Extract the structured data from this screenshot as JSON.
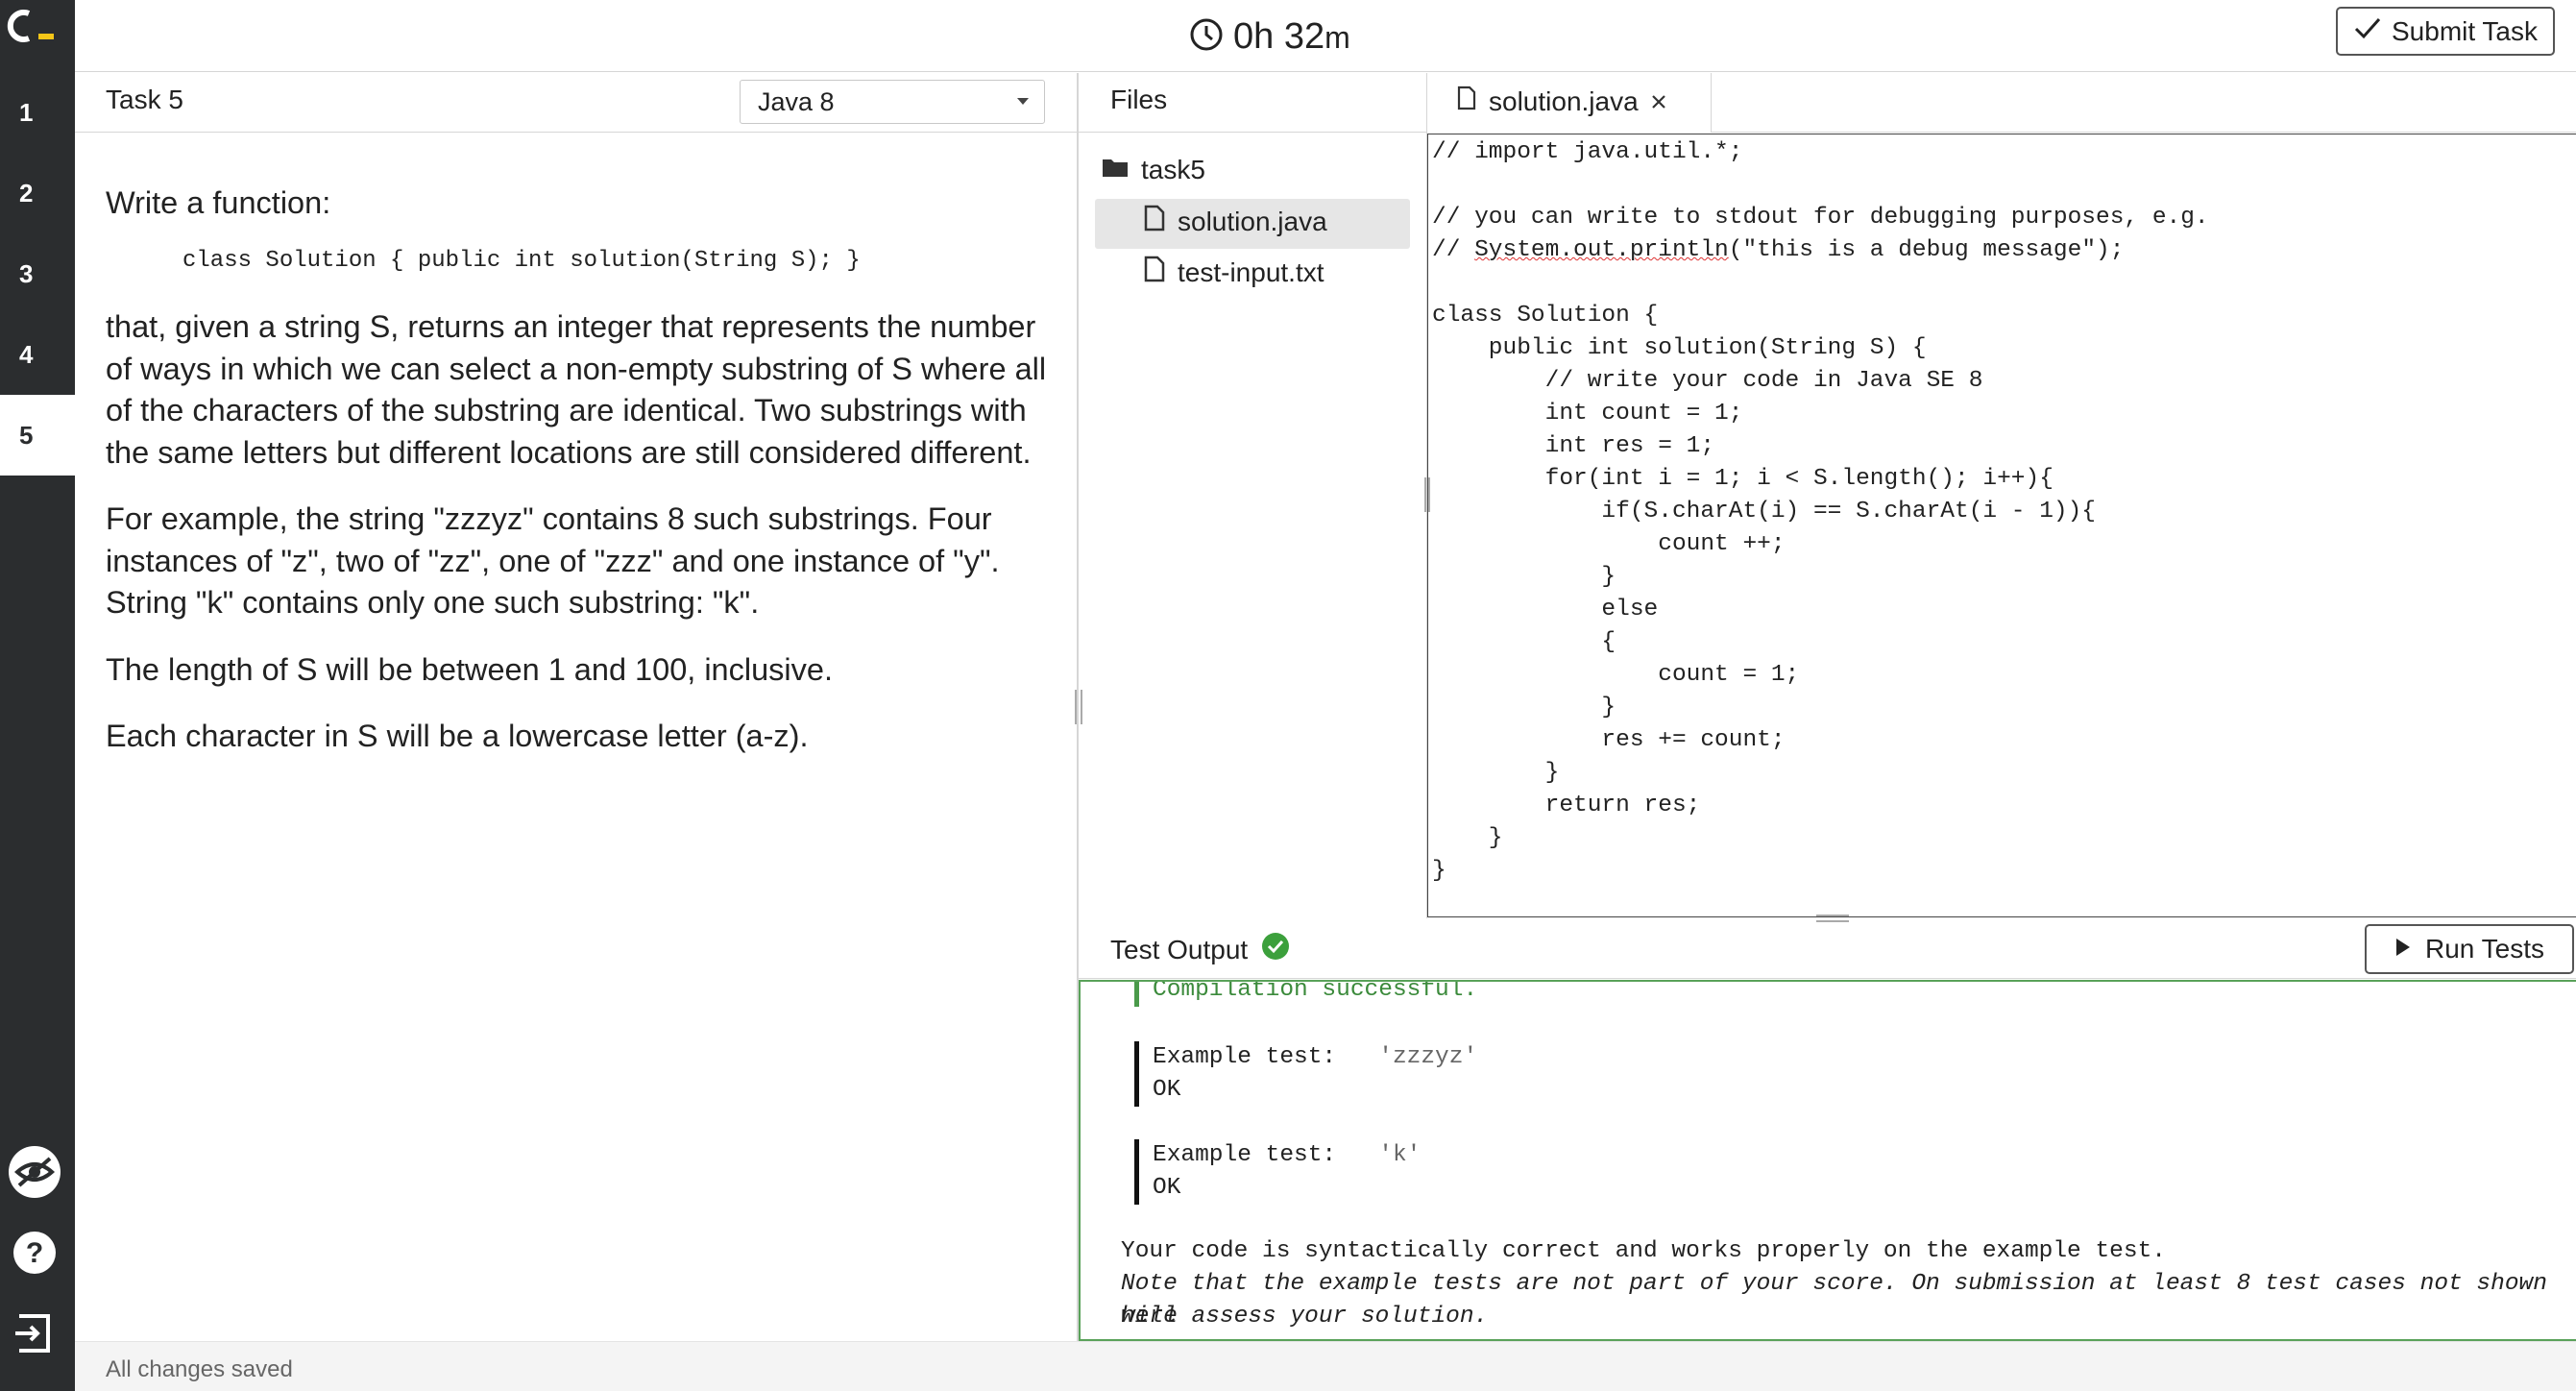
{
  "nav": {
    "items": [
      "1",
      "2",
      "3",
      "4",
      "5"
    ],
    "active_index": 4
  },
  "timer": {
    "hours": "0h",
    "minutes": "32",
    "minutes_unit": "m"
  },
  "submit_label": "Submit Task",
  "task": {
    "title": "Task 5",
    "language": "Java 8",
    "intro": "Write a function:",
    "signature": "class Solution { public int solution(String S); }",
    "paragraphs": [
      "that, given a string S, returns an integer that represents the number of ways in which we can select a non-empty substring of S where all of the characters of the substring are identical. Two substrings with the same letters but different locations are still considered different.",
      "For example, the string \"zzzyz\" contains 8 such substrings. Four instances of \"z\", two  of \"zz\", one  of \"zzz\" and one instance of \"y\". String \"k\" contains only one such substring: \"k\".",
      "The length of S will be between 1 and 100, inclusive.",
      "Each character in S will be a lowercase letter (a-z)."
    ]
  },
  "files": {
    "title": "Files",
    "folder": "task5",
    "items": [
      "solution.java",
      "test-input.txt"
    ],
    "selected": "solution.java"
  },
  "editor": {
    "tab_label": "solution.java",
    "lines": [
      "// import java.util.*;",
      "",
      "// you can write to stdout for debugging purposes, e.g.",
      "// System.out.println(\"this is a debug message\");",
      "",
      "class Solution {",
      "    public int solution(String S) {",
      "        // write your code in Java SE 8",
      "        int count = 1;",
      "        int res = 1;",
      "        for(int i = 1; i < S.length(); i++){",
      "            if(S.charAt(i) == S.charAt(i - 1)){",
      "                count ++;",
      "            }",
      "            else",
      "            {",
      "                count = 1;",
      "            }",
      "            res += count;",
      "        }",
      "        return res;",
      "    }",
      "}"
    ]
  },
  "output": {
    "title": "Test Output",
    "run_label": "Run Tests",
    "compile_msg": "Compilation successful.",
    "tests": [
      {
        "label": "Example test:",
        "input": "'zzzyz'",
        "result": "OK"
      },
      {
        "label": "Example test:",
        "input": "'k'",
        "result": "OK"
      }
    ],
    "summary": "Your code is syntactically correct and works properly on the example test.",
    "note_line1": "Note that the example tests are not part of your score. On submission at least 8 test cases not shown here",
    "note_line2": "will assess your solution."
  },
  "status": "All changes saved",
  "colors": {
    "nav_bg": "#2b2d2f",
    "logo_accent": "#f5c518",
    "success": "#3ca03c"
  }
}
